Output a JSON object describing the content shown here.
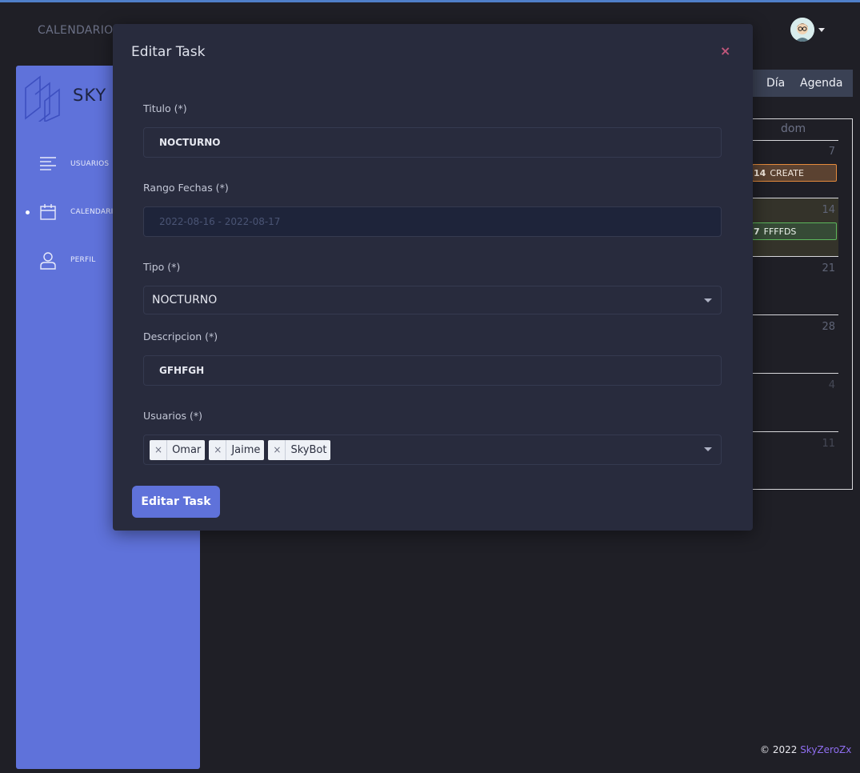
{
  "header": {
    "page_title": "CALENDARIO",
    "avatar_icon": "avatar-icon"
  },
  "sidebar": {
    "brand": "SKY Z",
    "items": [
      {
        "label": "USUARIOS",
        "icon": "list-icon",
        "active": false
      },
      {
        "label": "CALENDARIO",
        "icon": "calendar-icon",
        "active": true
      },
      {
        "label": "PERFIL",
        "icon": "user-icon",
        "active": false
      }
    ]
  },
  "calendar": {
    "views": [
      "Día",
      "Agenda"
    ],
    "day_header": "dom",
    "day_numbers": [
      "7",
      "14",
      "21",
      "28",
      "4",
      "11"
    ],
    "events": [
      {
        "time": "14",
        "title": "CREATE",
        "color": "#e58b3c"
      },
      {
        "time": "7",
        "title": "FFFFDS",
        "color": "#5cb65c"
      }
    ]
  },
  "modal": {
    "title": "Editar Task",
    "close_symbol": "×",
    "fields": {
      "titulo": {
        "label": "Titulo (*)",
        "value": "NOCTURNO"
      },
      "rango": {
        "label": "Rango Fechas (*)",
        "value": "2022-08-16 - 2022-08-17"
      },
      "tipo": {
        "label": "Tipo (*)",
        "value": "NOCTURNO"
      },
      "descripcion": {
        "label": "Descripcion (*)",
        "value": "GFHFGH"
      },
      "usuarios": {
        "label": "Usuarios (*)",
        "tags": [
          "Omar",
          "Jaime",
          "SkyBot"
        ],
        "remove_symbol": "×"
      }
    },
    "submit_label": "Editar Task"
  },
  "footer": {
    "copyright": "© 2022",
    "author": "SkyZeroZx"
  },
  "colors": {
    "sidebar": "#5f72da",
    "modal_bg": "#282b3d",
    "page_bg": "#1f1f26",
    "accent_link": "#8f6ef0"
  }
}
